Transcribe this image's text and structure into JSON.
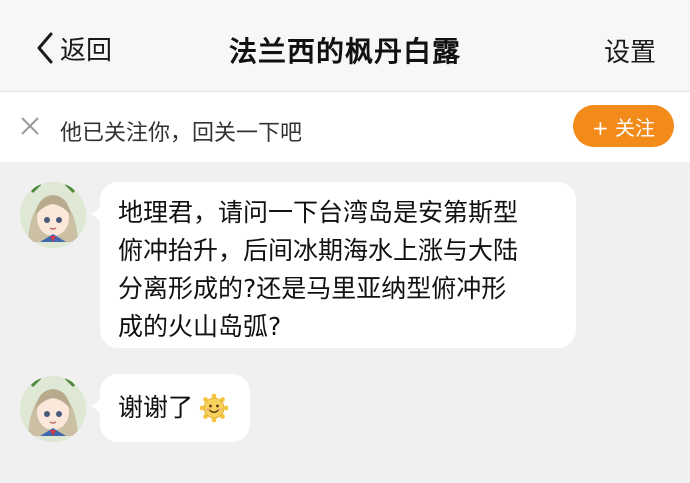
{
  "nav": {
    "back_label": "返回",
    "title": "法兰西的枫丹白露",
    "settings_label": "设置"
  },
  "follow_bar": {
    "text": "他已关注你，回关一下吧",
    "button_label": "+ 关注"
  },
  "messages": [
    {
      "lines": [
        "地理君，请问一下台湾岛是安第斯型",
        "俯冲抬升，后间冰期海水上涨与大陆",
        "分离形成的?还是马里亚纳型俯冲形",
        "成的火山岛弧?"
      ]
    },
    {
      "text": "谢谢了",
      "emoji": "smiley-sun-icon"
    }
  ],
  "colors": {
    "accent": "#f38b1b",
    "background": "#f0f0f0",
    "bubble": "#ffffff"
  }
}
